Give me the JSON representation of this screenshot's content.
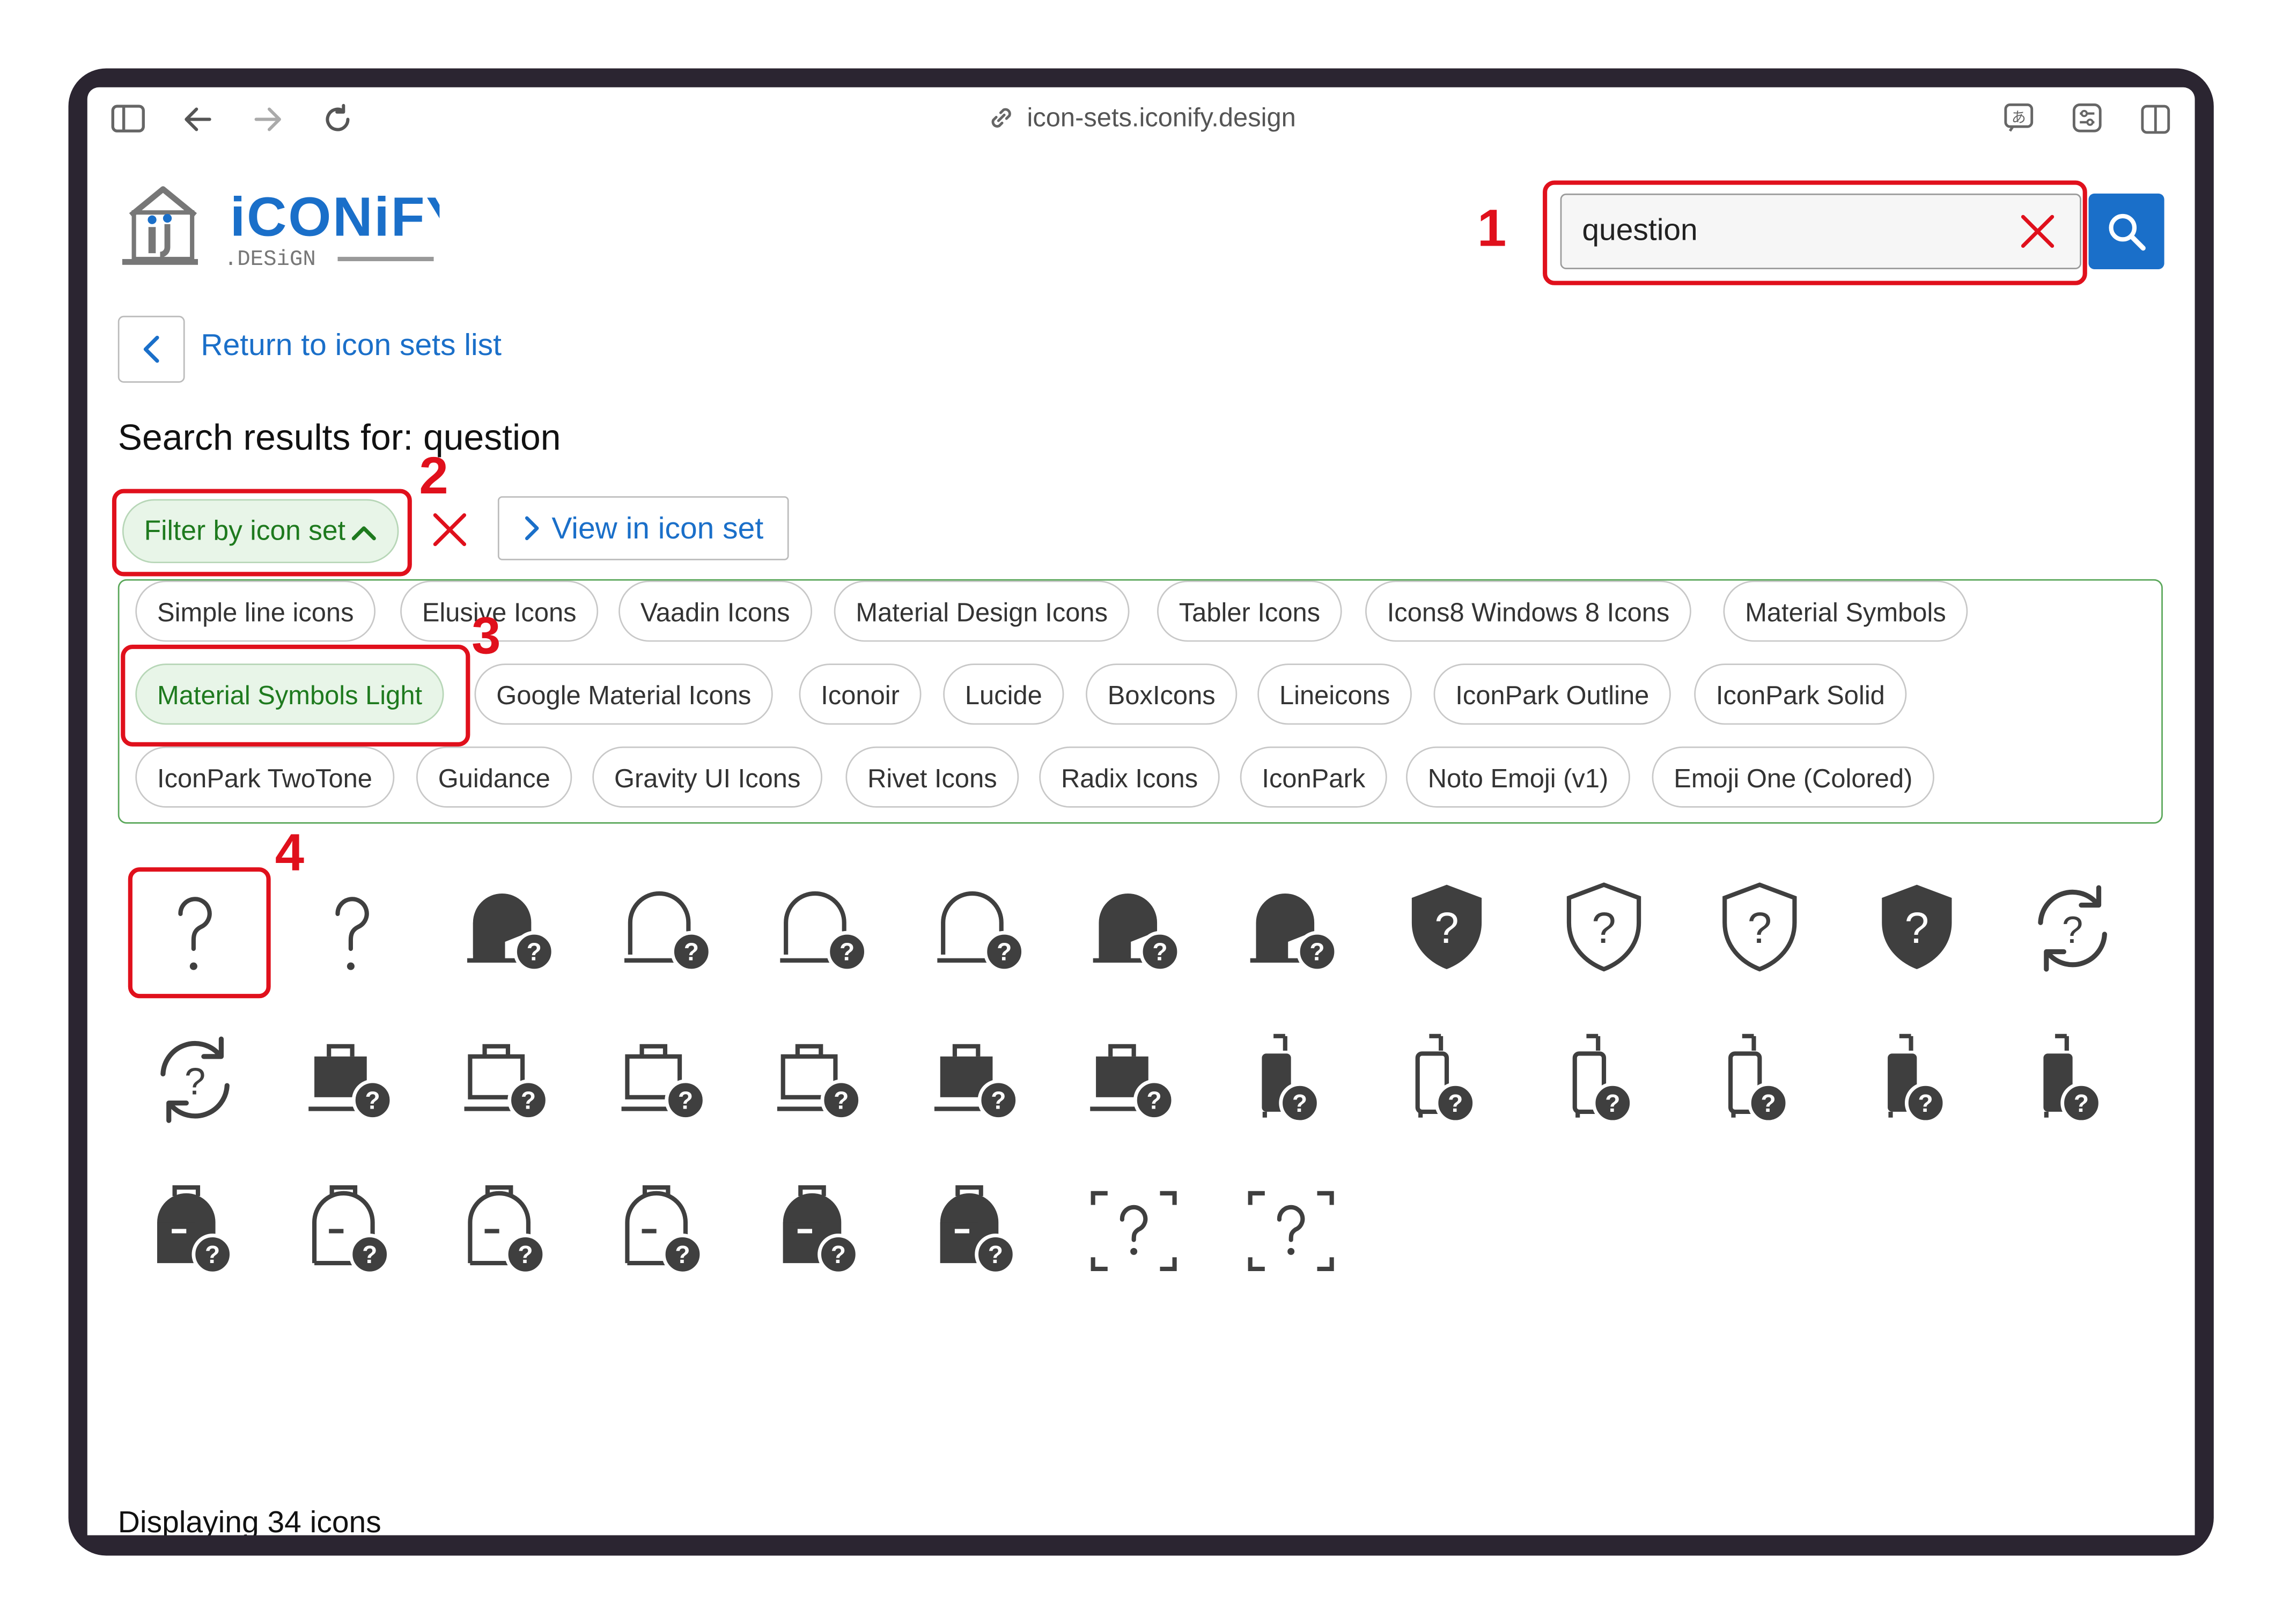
{
  "browser": {
    "url": "icon-sets.iconify.design",
    "icons": [
      "sidebar-icon",
      "back-arrow-icon",
      "forward-arrow-icon",
      "reload-icon",
      "link-icon",
      "translate-icon",
      "extensions-icon",
      "split-view-icon"
    ]
  },
  "header": {
    "logo_main": "iCONiFY",
    "logo_sub": ".DESiGN",
    "search_value": "question",
    "search_clear_icon": "close-icon",
    "search_icon": "search-icon"
  },
  "nav": {
    "back_label": "Return to icon sets list"
  },
  "results": {
    "title": "Search results for: question"
  },
  "filters": {
    "toggle_label": "Filter by icon set",
    "view_label": "View in icon set",
    "sets": [
      "Simple line icons",
      "Elusive Icons",
      "Vaadin Icons",
      "Material Design Icons",
      "Tabler Icons",
      "Icons8 Windows 8 Icons",
      "Material Symbols",
      "Material Symbols Light",
      "Google Material Icons",
      "Iconoir",
      "Lucide",
      "BoxIcons",
      "Lineicons",
      "IconPark Outline",
      "IconPark Solid",
      "IconPark TwoTone",
      "Guidance",
      "Gravity UI Icons",
      "Rivet Icons",
      "Radix Icons",
      "IconPark",
      "Noto Emoji (v1)",
      "Emoji One (Colored)"
    ],
    "selected": "Material Symbols Light"
  },
  "annotations": [
    "1",
    "2",
    "3",
    "4"
  ],
  "icons": [
    "question-mark",
    "question-mark",
    "contact-support-filled",
    "contact-support-outline",
    "contact-support-outline",
    "contact-support-outline",
    "contact-support-filled",
    "contact-support-filled",
    "shield-question-filled",
    "shield-question-outline",
    "shield-question-outline",
    "shield-question-filled",
    "sync-problem",
    "sync-problem",
    "work-question-filled",
    "work-question-outline",
    "work-question-outline",
    "work-question-outline",
    "work-question-filled",
    "work-question-filled",
    "luggage-question-filled",
    "luggage-question-outline",
    "luggage-question-outline",
    "luggage-question-outline",
    "luggage-question-filled",
    "luggage-question-filled",
    "backpack-question-filled",
    "backpack-question-outline",
    "backpack-question-outline",
    "backpack-question-outline",
    "backpack-question-filled",
    "backpack-question-filled",
    "scan-question",
    "scan-question"
  ],
  "footer": {
    "count_text": "Displaying 34 icons"
  },
  "colors": {
    "accent": "#1a6fc9",
    "selected_green": "#1e7a1e",
    "highlight_red": "#e0101c",
    "icon_gray": "#3f3f3f"
  }
}
